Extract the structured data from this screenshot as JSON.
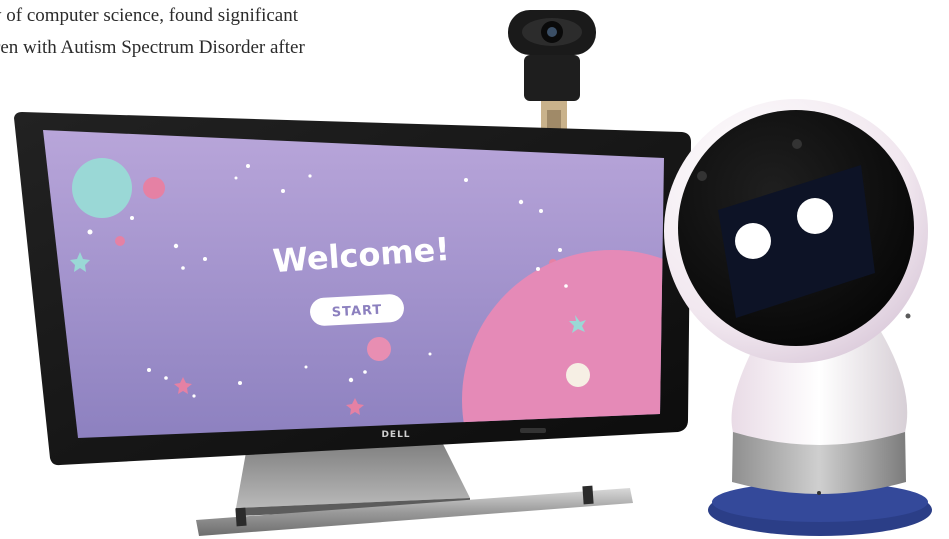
{
  "caption": {
    "line1": "y of computer science, found significant",
    "line2": "ren with Autism Spectrum Disorder after"
  },
  "monitor": {
    "brand": "DELL",
    "screen_title": "Welcome!",
    "start_button": "START",
    "screen_colors": {
      "top": "#b9a6da",
      "bottom": "#8c80bf",
      "planet": "#e58ab7"
    }
  },
  "robot": {
    "face_color": "#111111",
    "eye_color": "#ffffff",
    "body_color": "#eeeeee",
    "base_color": "#2b3e87"
  },
  "icons": [
    "webcam",
    "tablet-monitor",
    "robot"
  ]
}
